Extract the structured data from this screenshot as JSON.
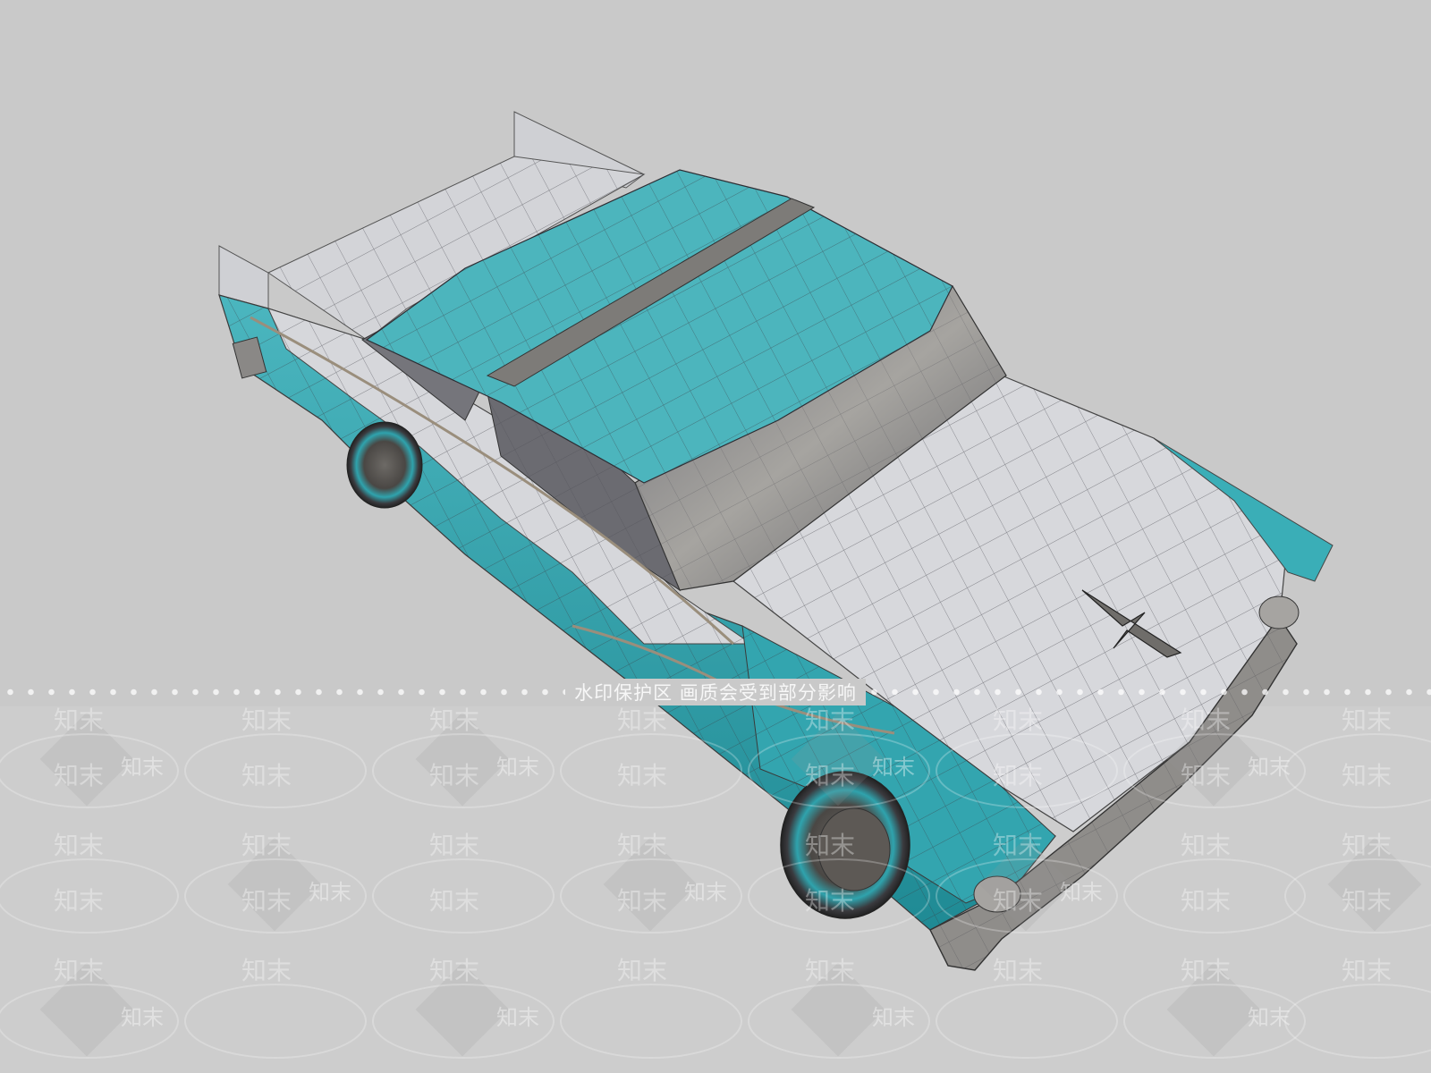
{
  "scene": {
    "subject_icon": "car-wireframe-icon",
    "colors": {
      "background": "#c9c9c9",
      "body_teal": "#35a8b2",
      "body_white": "#d8d8dc",
      "chrome": "#8a8a8a"
    }
  },
  "watermark": {
    "notice": "水印保护区 画质会受到部分影响",
    "brand": "知末"
  }
}
